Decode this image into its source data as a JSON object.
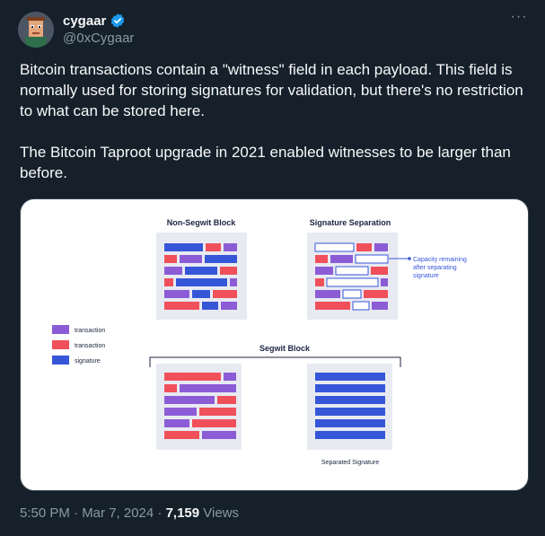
{
  "author": {
    "name": "cygaar",
    "handle": "@0xCygaar",
    "verified_color": "#1d9bf0"
  },
  "more_label": "···",
  "tweet": {
    "paragraph_1": "Bitcoin transactions contain a \"witness\" field in each payload. This field is normally used for storing signatures for validation, but there's no restriction to what can be stored here.",
    "paragraph_2": "The Bitcoin Taproot upgrade in 2021 enabled witnesses to be larger than before."
  },
  "diagram": {
    "non_segwit_title": "Non-Segwit Block",
    "sig_sep_title": "Signature Separation",
    "capacity_note_line1": "Capacity remaining",
    "capacity_note_line2": "after separating",
    "capacity_note_line3": "signature",
    "segwit_title": "Segwit Block",
    "separated_sig_label": "Separated Signature",
    "legend": [
      {
        "label": "transaction",
        "color": "#8b5cd6"
      },
      {
        "label": "transaction",
        "color": "#f0505a"
      },
      {
        "label": "signature",
        "color": "#3656d8"
      }
    ],
    "colors": {
      "purple": "#8b5cd6",
      "red": "#f0505a",
      "blue": "#3656d8",
      "block_bg": "#e8eaf2",
      "text": "#1c2541"
    }
  },
  "footer": {
    "timestamp": "5:50 PM · Mar 7, 2024 · ",
    "views_count": "7,159",
    "views_label": " Views"
  }
}
